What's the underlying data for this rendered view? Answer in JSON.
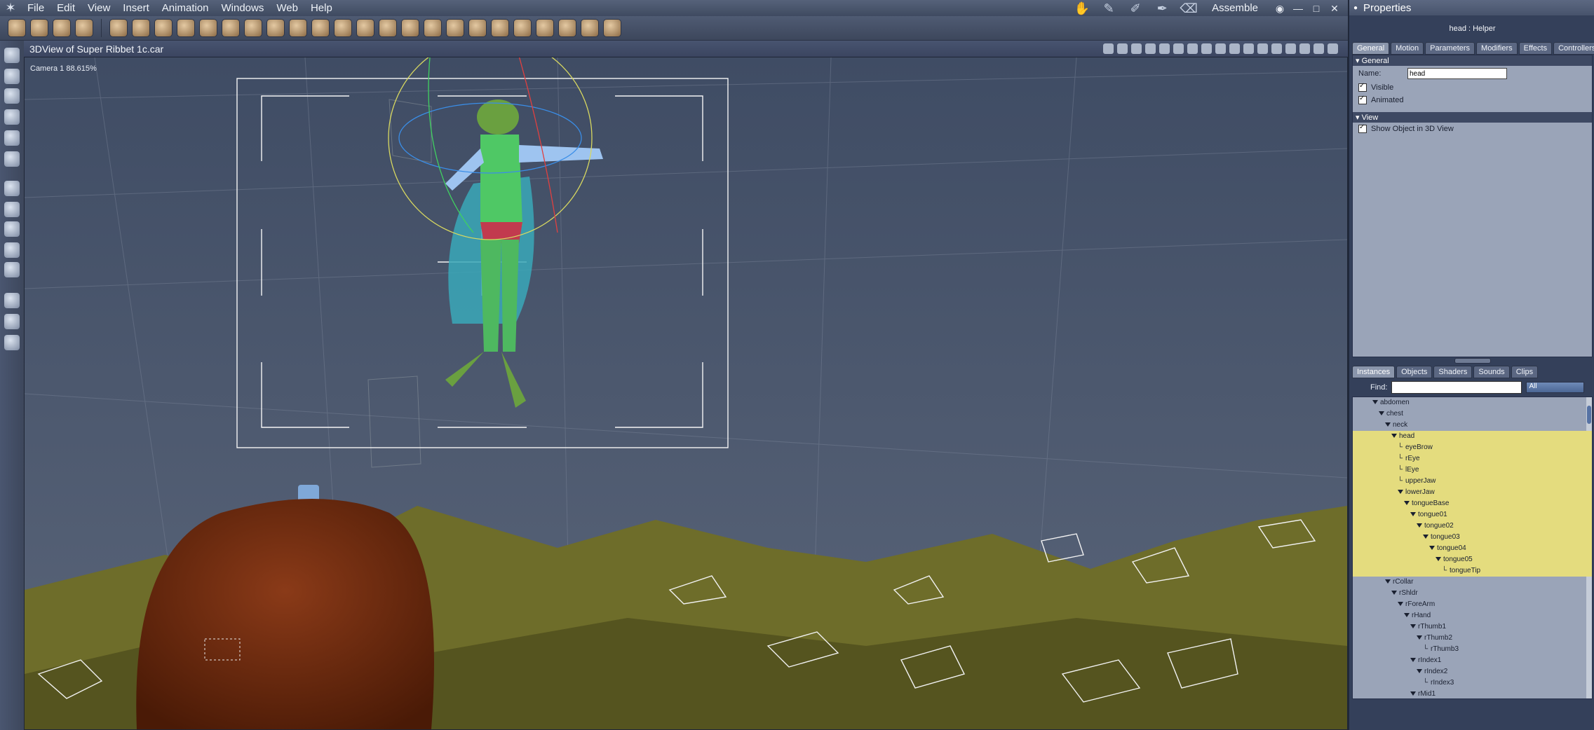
{
  "menubar": {
    "items": [
      "File",
      "Edit",
      "View",
      "Insert",
      "Animation",
      "Windows",
      "Web",
      "Help"
    ],
    "mode": "Assemble"
  },
  "viewport": {
    "title": "3DView of Super Ribbet 1c.car",
    "camera_label": "Camera 1 88.615%"
  },
  "properties": {
    "title": "Properties",
    "subtitle": "head : Helper",
    "tabs": [
      "General",
      "Motion",
      "Parameters",
      "Modifiers",
      "Effects",
      "Controllers"
    ],
    "general_section": "General",
    "name_label": "Name:",
    "name_value": "head",
    "visible_label": "Visible",
    "animated_label": "Animated",
    "view_section": "View",
    "show_label": "Show Object in 3D View"
  },
  "instances": {
    "tabs": [
      "Instances",
      "Objects",
      "Shaders",
      "Sounds",
      "Clips"
    ],
    "find_label": "Find:",
    "find_value": "",
    "filter": "All",
    "tree": [
      {
        "label": "abdomen",
        "depth": 0,
        "selected": false,
        "expander": true
      },
      {
        "label": "chest",
        "depth": 1,
        "selected": false,
        "expander": true
      },
      {
        "label": "neck",
        "depth": 2,
        "selected": false,
        "expander": true
      },
      {
        "label": "head",
        "depth": 3,
        "selected": true,
        "expander": true
      },
      {
        "label": "eyeBrow",
        "depth": 4,
        "selected": true,
        "expander": false
      },
      {
        "label": "rEye",
        "depth": 4,
        "selected": true,
        "expander": false
      },
      {
        "label": "lEye",
        "depth": 4,
        "selected": true,
        "expander": false
      },
      {
        "label": "upperJaw",
        "depth": 4,
        "selected": true,
        "expander": false
      },
      {
        "label": "lowerJaw",
        "depth": 4,
        "selected": true,
        "expander": true
      },
      {
        "label": "tongueBase",
        "depth": 5,
        "selected": true,
        "expander": true
      },
      {
        "label": "tongue01",
        "depth": 6,
        "selected": true,
        "expander": true
      },
      {
        "label": "tongue02",
        "depth": 7,
        "selected": true,
        "expander": true
      },
      {
        "label": "tongue03",
        "depth": 8,
        "selected": true,
        "expander": true
      },
      {
        "label": "tongue04",
        "depth": 9,
        "selected": true,
        "expander": true
      },
      {
        "label": "tongue05",
        "depth": 10,
        "selected": true,
        "expander": true
      },
      {
        "label": "tongueTip",
        "depth": 11,
        "selected": true,
        "expander": false
      },
      {
        "label": "rCollar",
        "depth": 2,
        "selected": false,
        "expander": true
      },
      {
        "label": "rShldr",
        "depth": 3,
        "selected": false,
        "expander": true
      },
      {
        "label": "rForeArm",
        "depth": 4,
        "selected": false,
        "expander": true
      },
      {
        "label": "rHand",
        "depth": 5,
        "selected": false,
        "expander": true
      },
      {
        "label": "rThumb1",
        "depth": 6,
        "selected": false,
        "expander": true
      },
      {
        "label": "rThumb2",
        "depth": 7,
        "selected": false,
        "expander": true
      },
      {
        "label": "rThumb3",
        "depth": 8,
        "selected": false,
        "expander": false
      },
      {
        "label": "rIndex1",
        "depth": 6,
        "selected": false,
        "expander": true
      },
      {
        "label": "rIndex2",
        "depth": 7,
        "selected": false,
        "expander": true
      },
      {
        "label": "rIndex3",
        "depth": 8,
        "selected": false,
        "expander": false
      },
      {
        "label": "rMid1",
        "depth": 6,
        "selected": false,
        "expander": true
      }
    ]
  }
}
